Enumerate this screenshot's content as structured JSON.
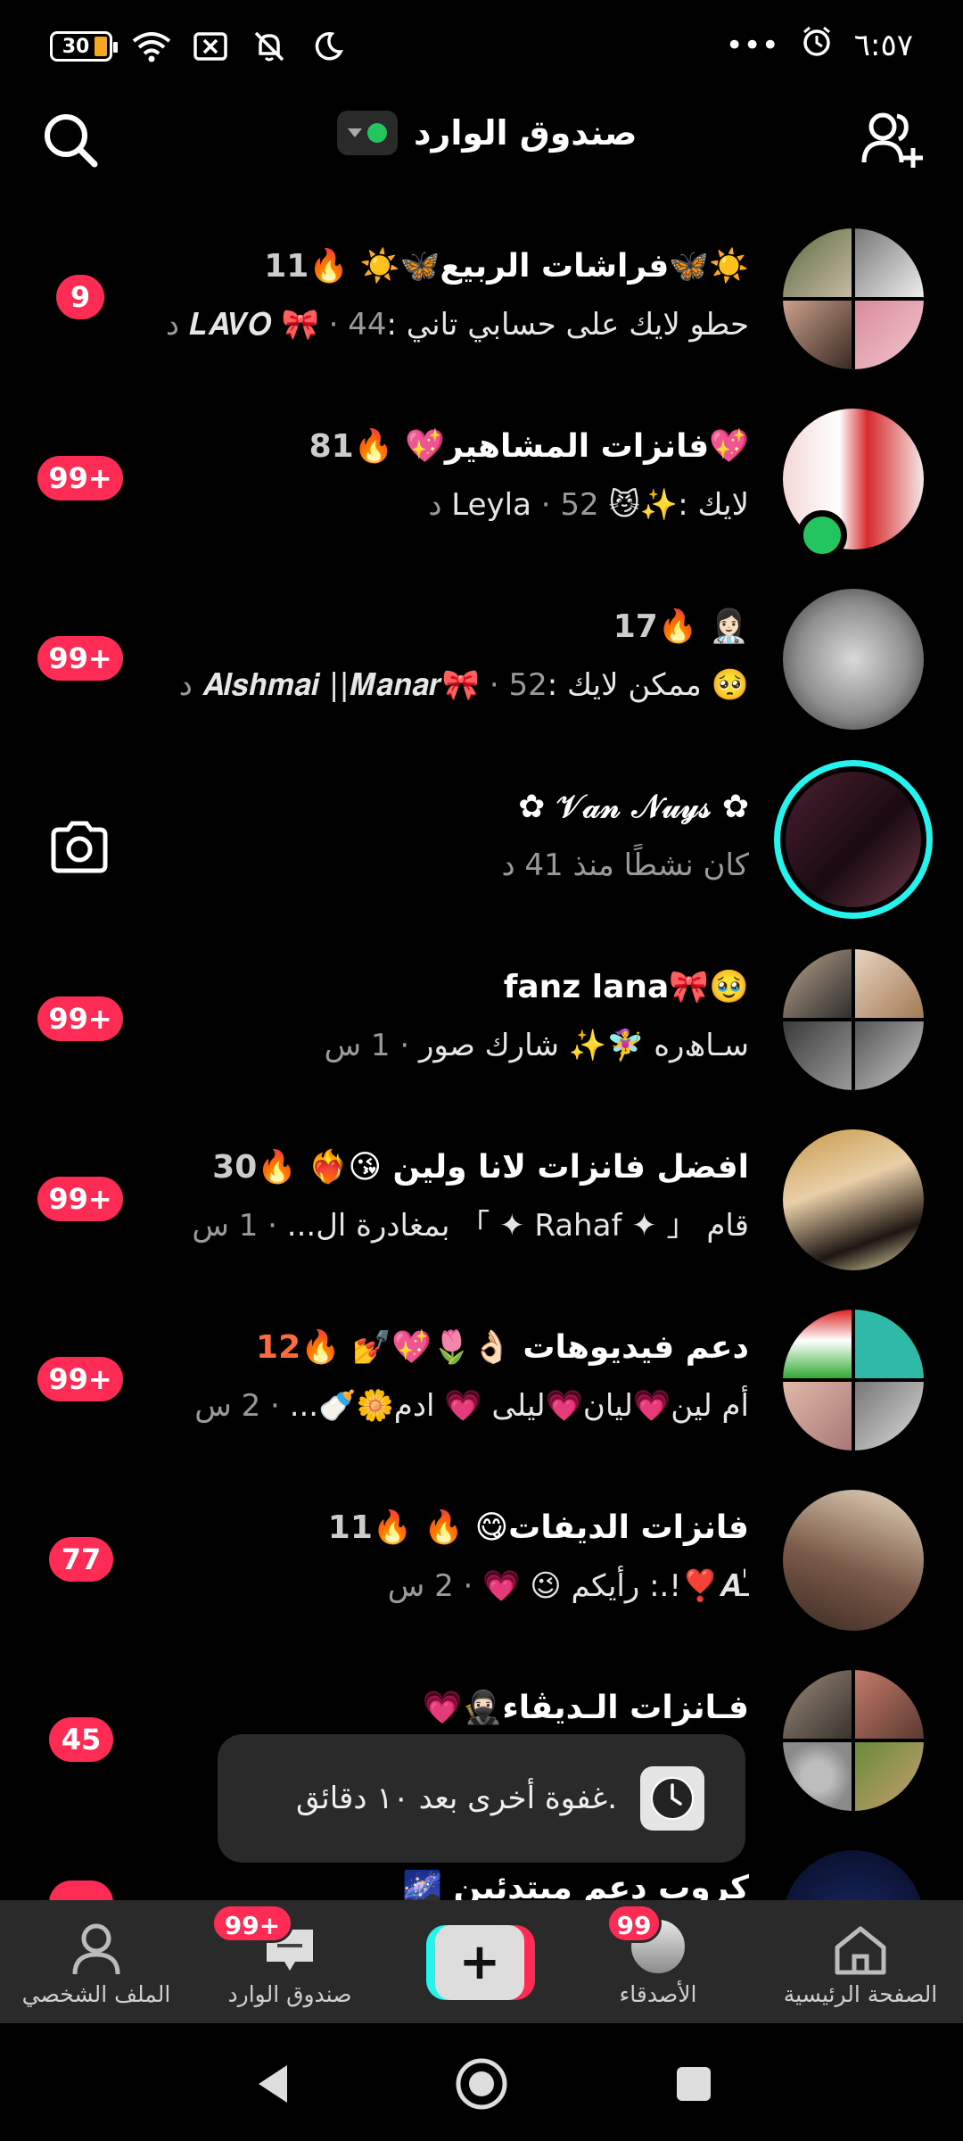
{
  "status_bar": {
    "battery": "30",
    "time": "٦:٥٧",
    "more": "•••"
  },
  "header": {
    "title": "صندوق الوارد"
  },
  "conversations": [
    {
      "title": "☀️🦋فراشات الربيع🦋☀️",
      "count": "11",
      "flame": "🔥",
      "preview": "حطو لايك على حسابي تاني :𝑳𝑨𝑽𝑶 🎀",
      "time": "· 44 د",
      "badge": "9"
    },
    {
      "title": "💖فانزات المشاهير💖",
      "count": "81",
      "flame": "🔥",
      "preview": "لايك :✨😼 Leyla",
      "time": "· 52 د",
      "badge": "99+"
    },
    {
      "title": "👩🏻‍⚕️",
      "count": "17",
      "flame": "🔥",
      "preview": "🥺 ممكن لايك :𝑨𝒍𝒔𝒉𝒎𝒂𝒊 ||𝑴𝒂𝒏𝒂𝒓🎀",
      "time": "· 52 د",
      "badge": "99+"
    },
    {
      "title": "✿ 𝒱𝒶𝓃 𝒩𝓊𝓎𝓈 ✿",
      "preview": "كان نشطًا منذ 41 د"
    },
    {
      "title": "🥹🎀fanz lana",
      "preview": "سـاﮪره 🧚‍♀️✨ شارك صور",
      "time": "· 1 س",
      "badge": "99+"
    },
    {
      "title": "افضل فانزات لانا ولين 😘❤️‍🔥",
      "count": "30",
      "flame": "🔥",
      "preview": "قام 「 ✦ Rahaf ✦ 」 بمغادرة ال...",
      "time": "· 1 س",
      "badge": "99+"
    },
    {
      "title": "دعم فيديوهات 👌🏻🌷💖💅",
      "count": "12",
      "flame": "🔥",
      "preview": "أم لين💗ليان💗ليلى 💗 ادم🌼🍼...",
      "time": "· 2 س",
      "badge": "99+"
    },
    {
      "title": "فانزات الديفات😋 🔥",
      "count": "11",
      "flame": "🔥",
      "preview": "ـٰٰ𝑨❣️!.: رأيكم 😉 💗",
      "time": "· 2 س",
      "badge": "77"
    },
    {
      "title": "فـانزات الـديڤاء🥷🏻💗",
      "preview": "",
      "time": "",
      "badge": "45"
    },
    {
      "title": "كروب دعم مبتدئين 🌌",
      "preview": "",
      "time": "",
      "badge": ""
    }
  ],
  "toast": {
    "text": "غفوة أخرى بعد ١٠ دقائق."
  },
  "tabbar": {
    "home": "الصفحة الرئيسية",
    "friends": "الأصدقاء",
    "friends_badge": "99",
    "plus": "+",
    "inbox": "صندوق الوارد",
    "inbox_badge": "99+",
    "profile": "الملف الشخصي"
  }
}
